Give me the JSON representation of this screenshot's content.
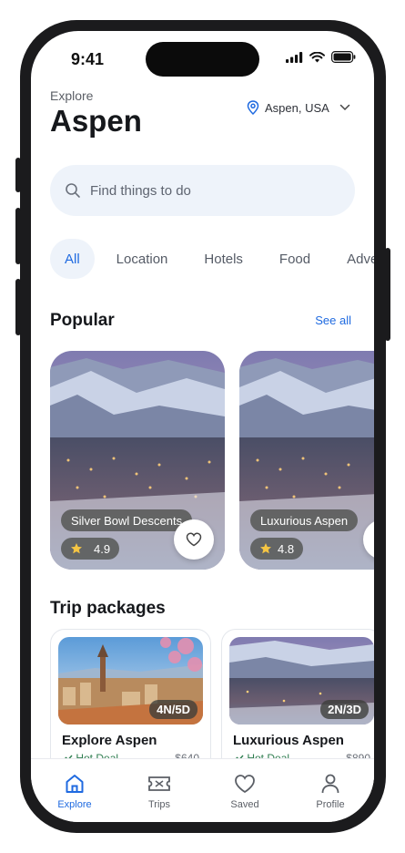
{
  "status_bar": {
    "time": "9:41"
  },
  "header": {
    "eyebrow": "Explore",
    "city": "Aspen",
    "location": "Aspen, USA"
  },
  "search": {
    "placeholder": "Find things to do"
  },
  "categories": [
    "All",
    "Location",
    "Hotels",
    "Food",
    "Adve"
  ],
  "popular": {
    "title": "Popular",
    "see_all": "See all",
    "cards": [
      {
        "name": "Silver Bowl Descents",
        "rating": "4.9"
      },
      {
        "name": "Luxurious Aspen",
        "rating": "4.8"
      }
    ]
  },
  "packages": {
    "title": "Trip packages",
    "items": [
      {
        "name": "Explore Aspen",
        "duration": "4N/5D",
        "deal": "Hot Deal",
        "price": "$640"
      },
      {
        "name": "Luxurious Aspen",
        "duration": "2N/3D",
        "deal": "Hot Deal",
        "price": "$890"
      }
    ]
  },
  "tabbar": {
    "tabs": [
      {
        "label": "Explore",
        "icon": "home-icon",
        "active": true
      },
      {
        "label": "Trips",
        "icon": "ticket-icon"
      },
      {
        "label": "Saved",
        "icon": "heart-icon"
      },
      {
        "label": "Profile",
        "icon": "person-icon"
      }
    ]
  },
  "colors": {
    "accent": "#1f6ae0",
    "chip_bg": "#eef3fa"
  }
}
